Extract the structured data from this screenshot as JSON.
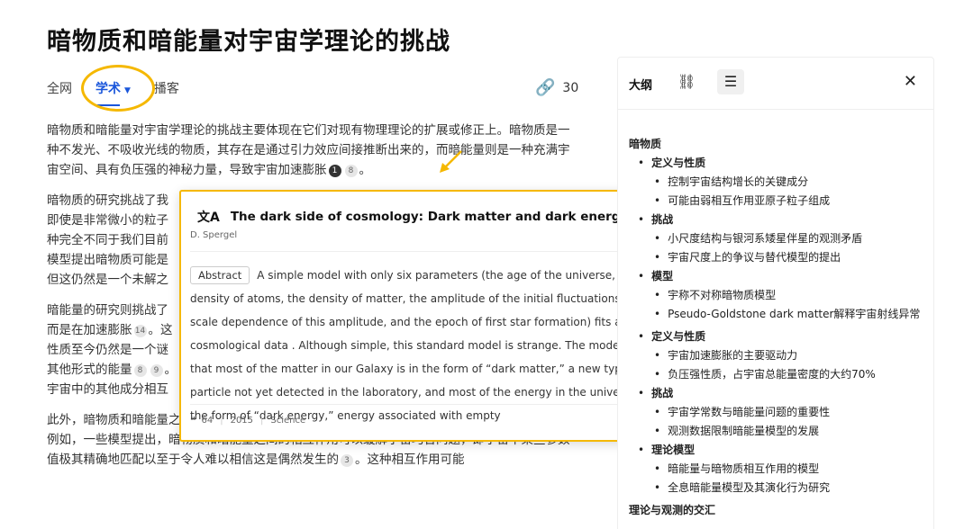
{
  "page": {
    "title": "暗物质和暗能量对宇宙学理论的挑战"
  },
  "tabs": [
    {
      "label": "全网"
    },
    {
      "label": "学术",
      "active": true
    },
    {
      "label": "播客"
    }
  ],
  "link_count": "30",
  "article": {
    "p1": {
      "text": "暗物质和暗能量对宇宙学理论的挑战主要体现在它们对现有物理理论的扩展或修正上。暗物质是一种不发光、不吸收光线的物质，其存在是通过引力效应间接推断出来的，而暗能量则是一种充满宇宙空间、具有负压强的神秘力量，导致宇宙加速膨胀",
      "cite1": "1",
      "cite2": "8",
      "end": "。"
    },
    "p2_lines": [
      "暗物质的研究挑战了我",
      "即使是非常微小的粒子",
      "种完全不同于我们目前",
      "模型提出暗物质可能是",
      "但这仍然是一个未解之"
    ],
    "p3": {
      "l1": "暗能量的研究则挑战了",
      "l2a": "而是在加速膨胀",
      "cite14": "14",
      "l2b": "。这",
      "l3": "性质至今仍然是一个谜",
      "l4a": "其他形式的能量",
      "cite8": "8",
      "cite9": "9",
      "l4b": "。",
      "l5": "宇宙中的其他成分相互"
    },
    "p4": {
      "text": "此外，暗物质和暗能量之间可能存在相互作用，这一假设为解决一些宇宙学问题提供了新的途径。例如，一些模型提出，暗物质和暗能量之间的相互作用可以缓解宇宙巧合问题，即宇宙中某些参数值极其精确地匹配以至于令人难以相信这是偶然发生的",
      "cite3": "3",
      "end": "。这种相互作用可能"
    }
  },
  "popup": {
    "title": "The dark side of cosmology: Dark matter and dark energy",
    "author": "D. Spergel",
    "abstract_label": "Abstract",
    "abstract_text": "A simple model with only six parameters (the age of the universe, the density of atoms, the density of matter, the amplitude of the initial fluctuations, the scale dependence of this amplitude, and the epoch of first star formation) fits all of our cosmological data . Although simple, this standard model is strange. The model implies that most of the matter in our Galaxy is in the form of “dark matter,” a new type of particle not yet detected in the laboratory, and most of the energy in the universe is in the form of “dark energy,” energy associated with empty",
    "citations": "64",
    "year": "2015",
    "venue": "Science"
  },
  "outline": {
    "title": "大纲",
    "sec1": "暗物质",
    "sec1_sub1": "定义与性质",
    "sec1_sub1_items": [
      "控制宇宙结构增长的关键成分",
      "可能由弱相互作用亚原子粒子组成"
    ],
    "sec1_sub2": "挑战",
    "sec1_sub2_items": [
      "小尺度结构与银河系矮星伴星的观测矛盾",
      "宇宙尺度上的争议与替代模型的提出"
    ],
    "sec1_sub3": "模型",
    "sec1_sub3_items": [
      "宇称不对称暗物质模型",
      "Pseudo-Goldstone dark matter解释宇宙射线异常"
    ],
    "sec2_sub1": "定义与性质",
    "sec2_sub1_items": [
      "宇宙加速膨胀的主要驱动力",
      "负压强性质，占宇宙总能量密度的大约70%"
    ],
    "sec2_sub2": "挑战",
    "sec2_sub2_items": [
      "宇宙学常数与暗能量问题的重要性",
      "观测数据限制暗能量模型的发展"
    ],
    "sec2_sub3": "理论模型",
    "sec2_sub3_items": [
      "暗能量与暗物质相互作用的模型",
      "全息暗能量模型及其演化行为研究"
    ],
    "sec3": "理论与观测的交汇"
  },
  "colors": {
    "highlight": "#f5b800",
    "accent": "#1a56db"
  }
}
